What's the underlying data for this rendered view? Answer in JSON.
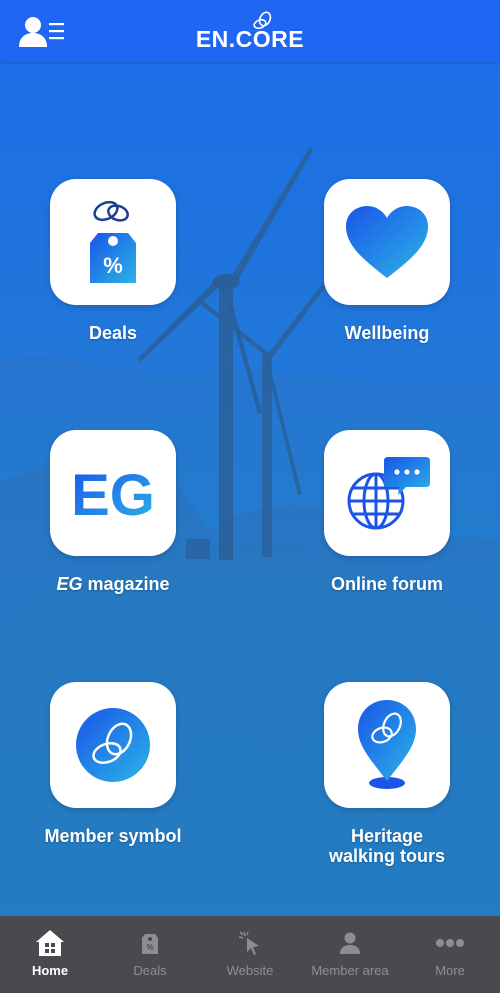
{
  "header": {
    "brand": "EN.CORE",
    "menu_icon": "user-menu-icon",
    "color": "#1f66f2"
  },
  "tiles": [
    {
      "label": "Deals",
      "icon": "price-tag-percent-icon"
    },
    {
      "label": "Wellbeing",
      "icon": "heart-icon"
    },
    {
      "label_italic": "EG",
      "label_rest": " magazine",
      "icon_text": "EG"
    },
    {
      "label": "Online forum",
      "icon": "globe-chat-icon"
    },
    {
      "label": "Member symbol",
      "icon": "member-symbol-icon"
    },
    {
      "label_line1": "Heritage",
      "label_line2": "walking tours",
      "icon": "map-pin-icon"
    }
  ],
  "tabbar": {
    "active": "Home",
    "items": [
      {
        "label": "Home",
        "icon": "home-icon"
      },
      {
        "label": "Deals",
        "icon": "deals-tag-icon"
      },
      {
        "label": "Website",
        "icon": "cursor-click-icon"
      },
      {
        "label": "Member area",
        "icon": "person-icon"
      },
      {
        "label": "More",
        "icon": "more-dots-icon"
      }
    ]
  },
  "colors": {
    "accent": "#1f66f2",
    "tabbar_bg": "#4a4a4e",
    "tab_inactive": "#8d8d93",
    "tab_active": "#ffffff"
  }
}
